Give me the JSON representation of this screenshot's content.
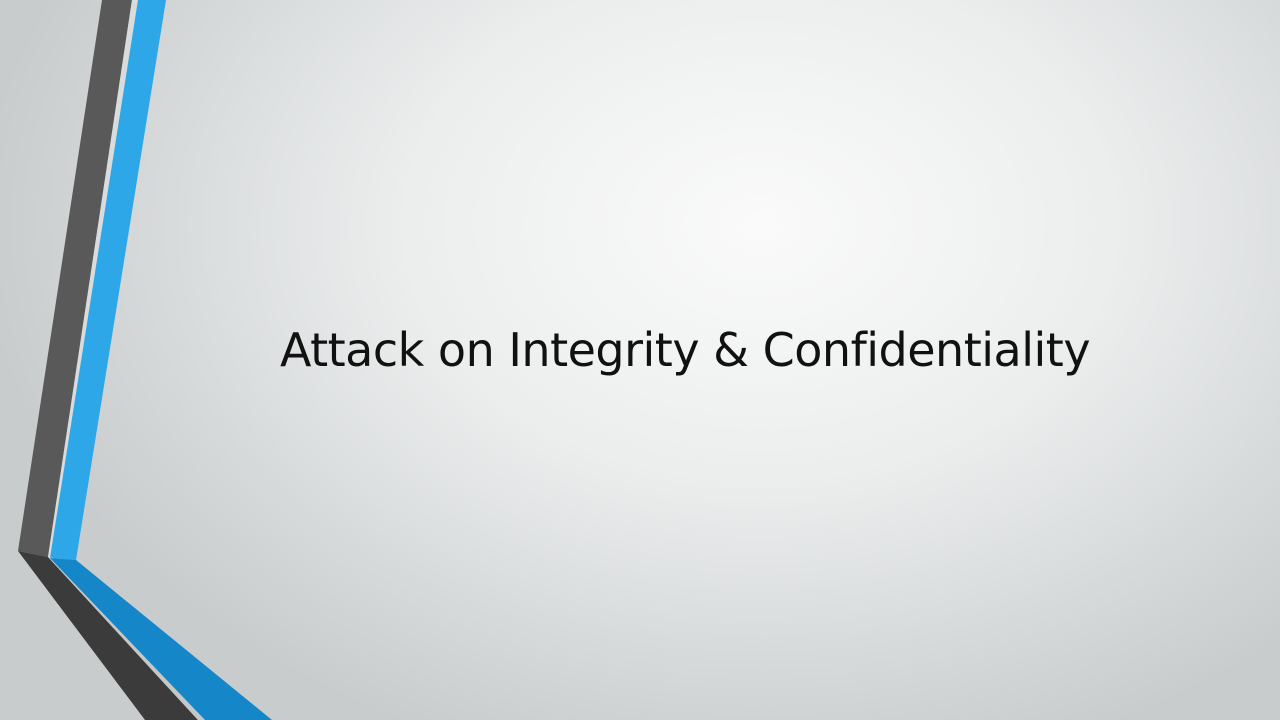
{
  "slide": {
    "title": "Attack on Integrity & Confidentiality"
  },
  "theme": {
    "accent_blue": "#2ea7e8",
    "accent_blue_dark": "#1587c9",
    "accent_gray": "#595959",
    "accent_gray_dark": "#3b3b3b",
    "background_center": "#fafafa",
    "background_edge": "#c9cccd",
    "text_color": "#111111"
  }
}
